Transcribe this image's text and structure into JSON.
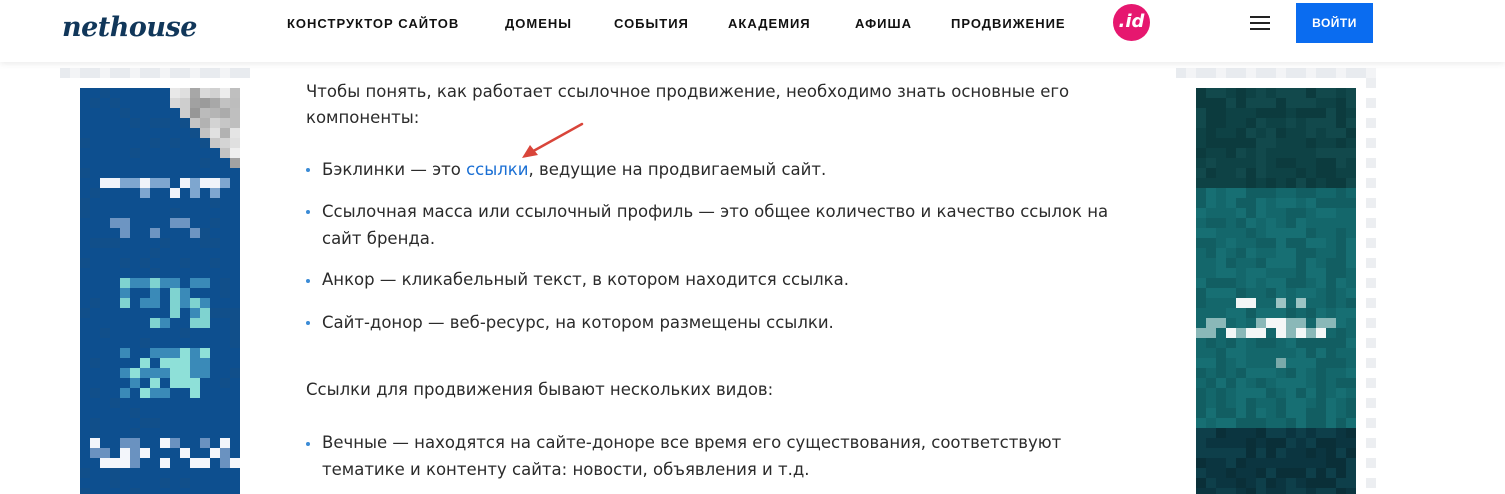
{
  "header": {
    "logo": "nethouse",
    "nav": [
      "КОНСТРУКТОР САЙТОВ",
      "ДОМЕНЫ",
      "СОБЫТИЯ",
      "АКАДЕМИЯ",
      "АФИША",
      "ПРОДВИЖЕНИЕ"
    ],
    "id_badge": ".id",
    "login_label": "ВОЙТИ"
  },
  "article": {
    "intro": "Чтобы понять, как работает ссылочное продвижение, необходимо знать основные его компоненты:",
    "bullets1": [
      {
        "before": "Бэклинки — это ",
        "link": "ссылки",
        "after": ", ведущие на продвигаемый сайт."
      },
      {
        "text": "Ссылочная масса или ссылочный профиль — это общее количество и качество ссылок на сайт бренда."
      },
      {
        "text": "Анкор — кликабельный текст, в котором находится ссылка."
      },
      {
        "text": "Сайт-донор — веб-ресурс, на котором размещены ссылки."
      }
    ],
    "types_intro": "Ссылки для продвижения бывают нескольких видов:",
    "bullets2": [
      {
        "text": "Вечные — находятся на сайте-доноре все время его существования, соответствуют тематике и контенту сайта: новости, объявления и т.д."
      }
    ]
  },
  "colors": {
    "accent": "#0a6cf0",
    "link": "#1a6fd4",
    "id_badge": "#e6176f",
    "annotation_arrow": "#d9453a"
  }
}
